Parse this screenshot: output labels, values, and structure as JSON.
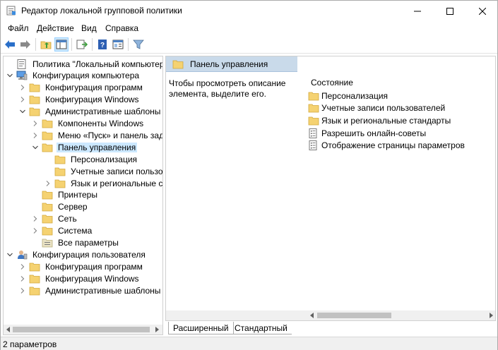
{
  "window": {
    "title": "Редактор локальной групповой политики"
  },
  "menu": [
    "Файл",
    "Действие",
    "Вид",
    "Справка"
  ],
  "toolbar": {
    "buttons": [
      "back-arrow-icon",
      "forward-arrow-icon",
      "up-folder-icon",
      "show-hide-tree-icon",
      "export-list-icon",
      "help-icon",
      "properties-icon",
      "filter-icon"
    ]
  },
  "tree": {
    "items": [
      {
        "label": "Политика \"Локальный компьютер\""
      },
      {
        "label": "Конфигурация компьютера"
      },
      {
        "label": "Конфигурация программ"
      },
      {
        "label": "Конфигурация Windows"
      },
      {
        "label": "Административные шаблоны"
      },
      {
        "label": "Компоненты Windows"
      },
      {
        "label": "Меню «Пуск» и панель задач"
      },
      {
        "label": "Панель управления"
      },
      {
        "label": "Персонализация"
      },
      {
        "label": "Учетные записи пользователей"
      },
      {
        "label": "Язык и региональные стандарты"
      },
      {
        "label": "Принтеры"
      },
      {
        "label": "Сервер"
      },
      {
        "label": "Сеть"
      },
      {
        "label": "Система"
      },
      {
        "label": "Все параметры"
      },
      {
        "label": "Конфигурация пользователя"
      },
      {
        "label": "Конфигурация программ"
      },
      {
        "label": "Конфигурация Windows"
      },
      {
        "label": "Административные шаблоны"
      }
    ]
  },
  "right": {
    "header": "Панель управления",
    "description": "Чтобы просмотреть описание элемента, выделите его.",
    "column": "Состояние",
    "items": [
      {
        "label": "Персонализация",
        "type": "folder"
      },
      {
        "label": "Учетные записи пользователей",
        "type": "folder"
      },
      {
        "label": "Язык и региональные стандарты",
        "type": "folder"
      },
      {
        "label": "Разрешить онлайн-советы",
        "type": "setting"
      },
      {
        "label": "Отображение страницы параметров",
        "type": "setting"
      }
    ]
  },
  "tabs": [
    "Расширенный",
    "Стандартный"
  ],
  "status": "2 параметров",
  "colors": {
    "header_bg": "#c9daea",
    "selection": "#cce8ff",
    "folder": "#f5d271"
  }
}
